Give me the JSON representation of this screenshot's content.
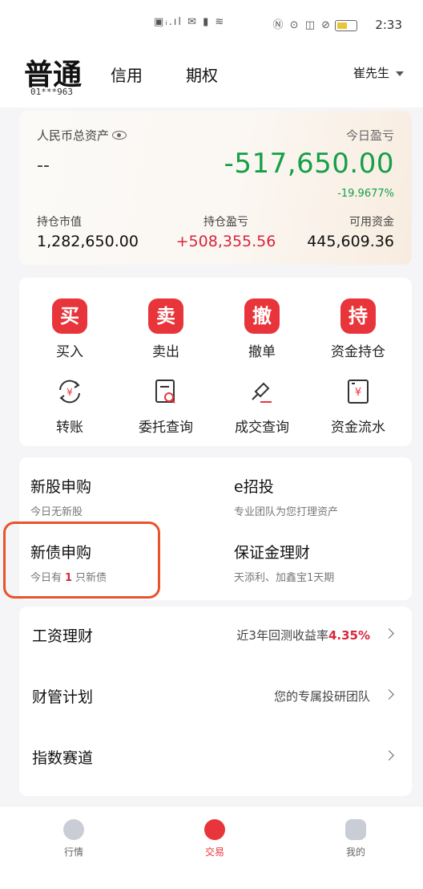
{
  "status_bar": {
    "left_icons": "▣ᵢ.ıl ✉ ▮ ≋",
    "right_icons": "Ⓝ ⊙ ◫ ⊘",
    "time": "2:33"
  },
  "header": {
    "tabs": [
      {
        "label": "普通"
      },
      {
        "label": "信用"
      },
      {
        "label": "期权"
      }
    ],
    "account_no": "01***963",
    "user": "崔先生"
  },
  "asset": {
    "total_label": "人民币总资产",
    "total_value": "--",
    "pl_label": "今日盈亏",
    "pl_value": "-517,650.00",
    "pl_pct": "-19.9677%",
    "stats": [
      {
        "label": "持仓市值",
        "value": "1,282,650.00"
      },
      {
        "label": "持仓盈亏",
        "value": "+508,355.56"
      },
      {
        "label": "可用资金",
        "value": "445,609.36"
      }
    ],
    "colors": {
      "loss": "#13a046",
      "gain": "#d7263d"
    }
  },
  "quick_actions": [
    {
      "badge": "买",
      "label": "买入"
    },
    {
      "badge": "卖",
      "label": "卖出"
    },
    {
      "badge": "撤",
      "label": "撤单"
    },
    {
      "badge": "持",
      "label": "资金持仓"
    },
    {
      "icon": "transfer-icon",
      "label": "转账"
    },
    {
      "icon": "order-query-icon",
      "label": "委托查询"
    },
    {
      "icon": "deal-query-icon",
      "label": "成交查询"
    },
    {
      "icon": "fund-flow-icon",
      "label": "资金流水"
    }
  ],
  "invest": {
    "ipo": {
      "title": "新股申购",
      "sub": "今日无新股"
    },
    "eguide": {
      "title": "e招投",
      "sub": "专业团队为您打理资产"
    },
    "bond": {
      "title": "新债申购",
      "sub_prefix": "今日有",
      "count": "1",
      "sub_suffix": "只新债"
    },
    "margin": {
      "title": "保证金理财",
      "sub": "天添利、加鑫宝1天期"
    }
  },
  "list": [
    {
      "title": "工资理财",
      "desc_prefix": "近3年回测收益率",
      "rate": "4.35%"
    },
    {
      "title": "财管计划",
      "desc_prefix": "您的专属投研团队",
      "rate": ""
    },
    {
      "title": "指数赛道",
      "desc_prefix": "",
      "rate": ""
    }
  ],
  "tabbar": [
    {
      "label": "行情"
    },
    {
      "label": "交易"
    },
    {
      "label": "我的"
    }
  ],
  "accent": "#e8353b"
}
